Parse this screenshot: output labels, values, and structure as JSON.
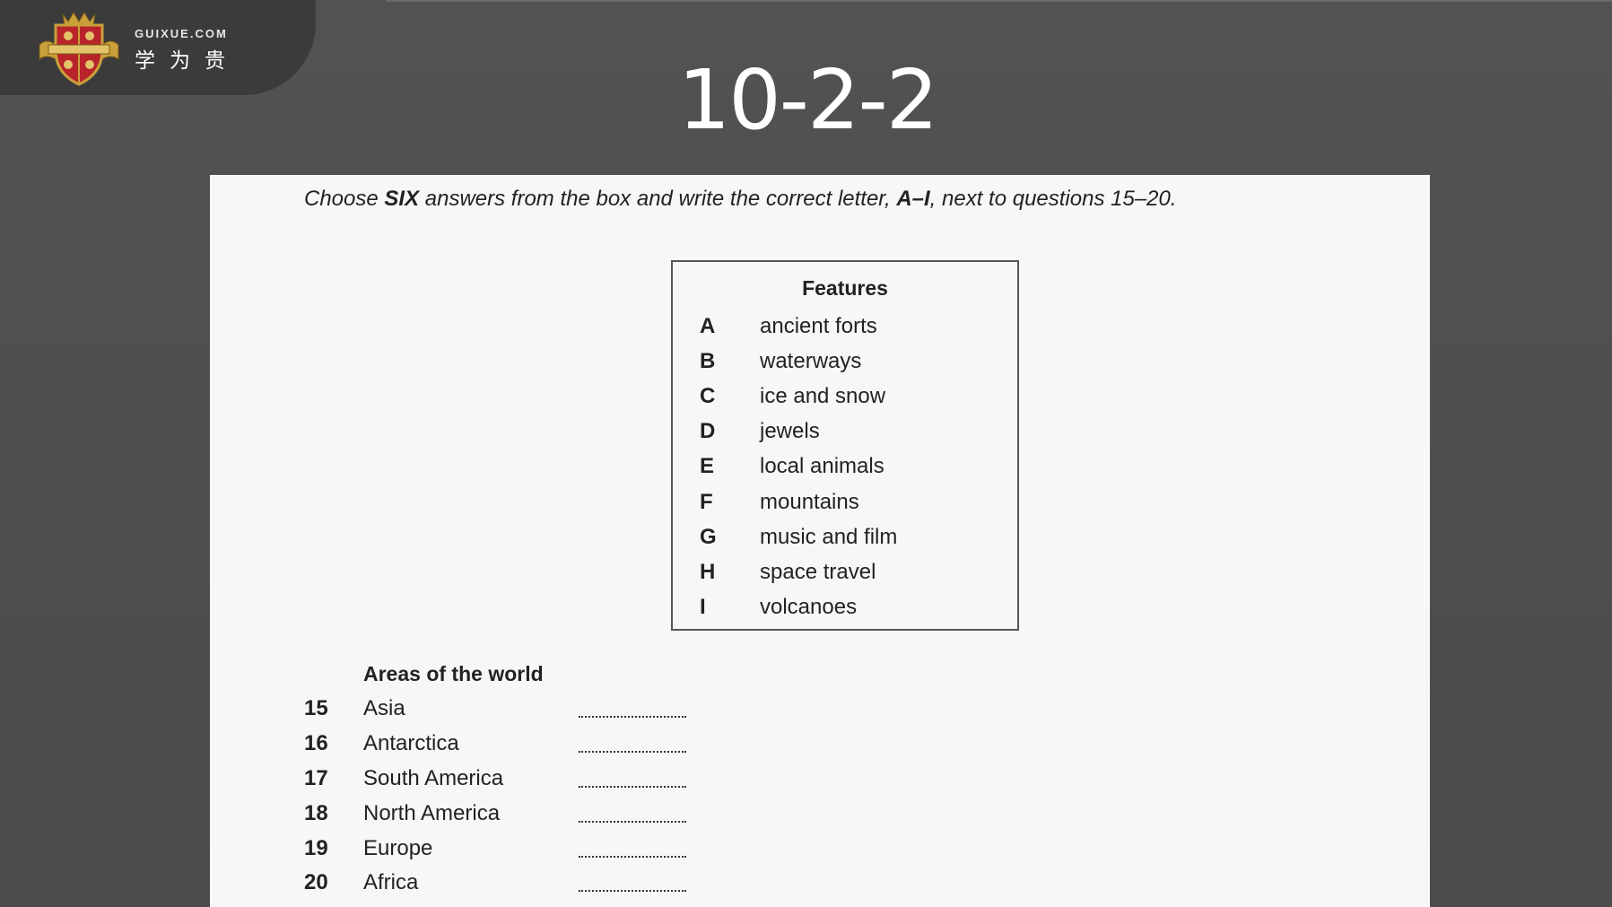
{
  "logo": {
    "brand": "GUIXUE.COM",
    "tagline": "学为贵",
    "crest_icon": "shield-crest-icon",
    "colors": {
      "gold": "#c9a03a",
      "red": "#b8242a"
    }
  },
  "slide": {
    "title": "10-2-2",
    "background": "#4f4f4f"
  },
  "document": {
    "instructions": {
      "part1": "Choose ",
      "bold1": "SIX",
      "part2": " answers from the box and write the correct letter, ",
      "bold2": "A–I",
      "part3": ", next to questions 15–20."
    },
    "features": {
      "heading": "Features",
      "items": [
        {
          "letter": "A",
          "text": "ancient forts"
        },
        {
          "letter": "B",
          "text": "waterways"
        },
        {
          "letter": "C",
          "text": "ice and snow"
        },
        {
          "letter": "D",
          "text": "jewels"
        },
        {
          "letter": "E",
          "text": "local animals"
        },
        {
          "letter": "F",
          "text": "mountains"
        },
        {
          "letter": "G",
          "text": "music and film"
        },
        {
          "letter": "H",
          "text": "space travel"
        },
        {
          "letter": "I",
          "text": "volcanoes"
        }
      ]
    },
    "areas": {
      "heading": "Areas of the world",
      "items": [
        {
          "number": "15",
          "name": "Asia",
          "answer": ""
        },
        {
          "number": "16",
          "name": "Antarctica",
          "answer": ""
        },
        {
          "number": "17",
          "name": "South America",
          "answer": ""
        },
        {
          "number": "18",
          "name": "North America",
          "answer": ""
        },
        {
          "number": "19",
          "name": "Europe",
          "answer": ""
        },
        {
          "number": "20",
          "name": "Africa",
          "answer": ""
        }
      ]
    }
  }
}
